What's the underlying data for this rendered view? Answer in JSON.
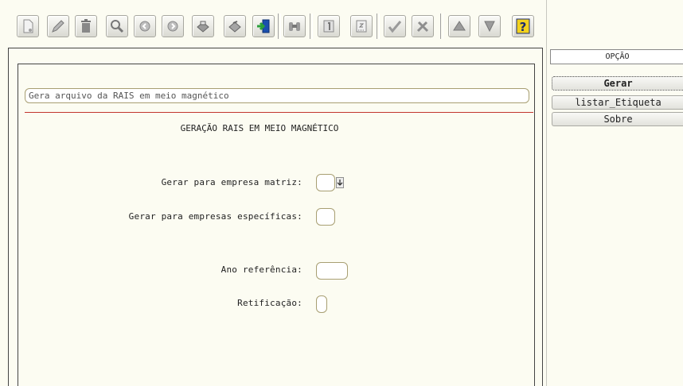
{
  "toolbar": {
    "buttons": [
      {
        "icon": "new-document-icon"
      },
      {
        "icon": "edit-pencil-icon"
      },
      {
        "icon": "trash-icon"
      },
      {
        "icon": "search-icon"
      },
      {
        "icon": "previous-icon"
      },
      {
        "icon": "next-icon"
      },
      {
        "icon": "printer-icon"
      },
      {
        "icon": "printer-alt-icon"
      },
      {
        "icon": "exit-icon"
      },
      {
        "icon": "binoculars-icon"
      },
      {
        "icon": "document-number-icon"
      },
      {
        "icon": "notebook-icon"
      },
      {
        "icon": "confirm-check-icon"
      },
      {
        "icon": "cancel-tools-icon"
      },
      {
        "icon": "triangle-up-icon"
      },
      {
        "icon": "triangle-down-icon"
      },
      {
        "icon": "help-icon"
      }
    ]
  },
  "form": {
    "description": "Gera arquivo da RAIS em meio magnético",
    "title": "GERAÇÃO RAIS EM MEIO MAGNÉTICO",
    "fields": {
      "matriz_label": "Gerar para empresa matriz:",
      "matriz_value": "",
      "especificas_label": "Gerar para empresas específicas:",
      "especificas_value": "",
      "ano_label": "Ano referência:",
      "ano_value": "",
      "retificacao_label": "Retificação:",
      "retificacao_value": ""
    }
  },
  "sidebar": {
    "header": "OPÇÃO",
    "options": [
      "Gerar",
      "listar_Etiqueta",
      "Sobre"
    ],
    "active_option": "Gerar"
  },
  "colors": {
    "background": "#fcfcf2",
    "separator_line": "#c2362e",
    "help_icon": "#f2d21e"
  }
}
